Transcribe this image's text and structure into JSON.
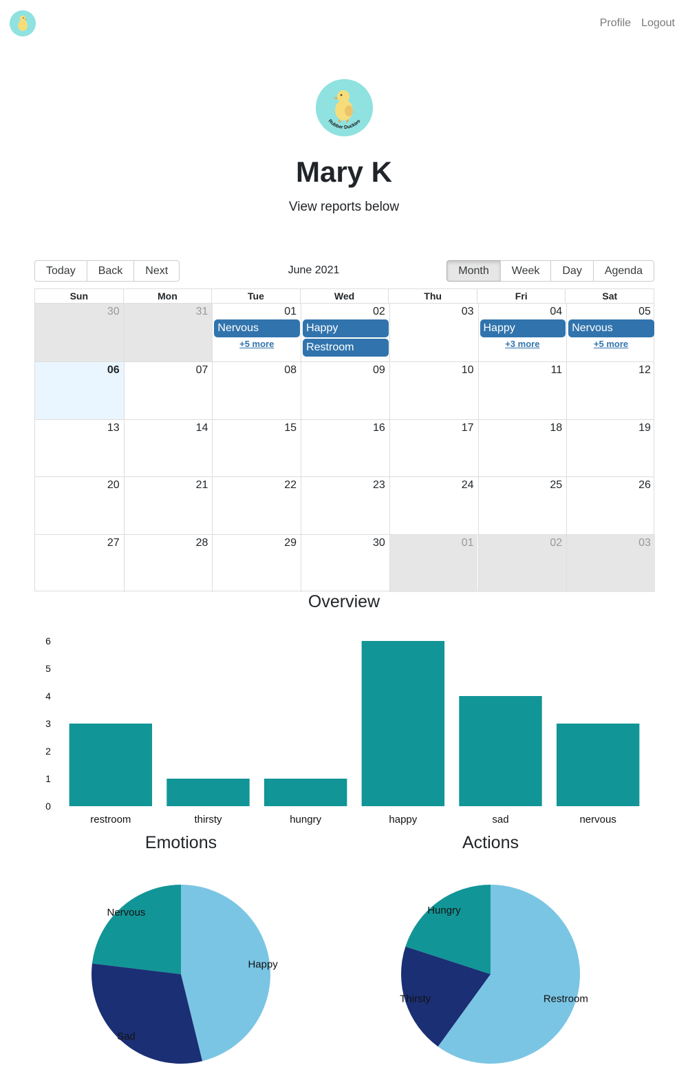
{
  "nav": {
    "links": [
      "Profile",
      "Logout"
    ]
  },
  "profile": {
    "logo_text": "Rubber Duckies",
    "name": "Mary K",
    "subtitle": "View reports below"
  },
  "calendar": {
    "nav_buttons": [
      "Today",
      "Back",
      "Next"
    ],
    "label": "June 2021",
    "views": [
      "Month",
      "Week",
      "Day",
      "Agenda"
    ],
    "active_view": "Month",
    "weekdays": [
      "Sun",
      "Mon",
      "Tue",
      "Wed",
      "Thu",
      "Fri",
      "Sat"
    ],
    "weeks": [
      [
        {
          "date": "30",
          "off": true
        },
        {
          "date": "31",
          "off": true
        },
        {
          "date": "01",
          "events": [
            "Nervous"
          ],
          "more": "+5 more"
        },
        {
          "date": "02",
          "events": [
            "Happy",
            "Restroom"
          ]
        },
        {
          "date": "03"
        },
        {
          "date": "04",
          "events": [
            "Happy"
          ],
          "more": "+3 more"
        },
        {
          "date": "05",
          "events": [
            "Nervous"
          ],
          "more": "+5 more"
        }
      ],
      [
        {
          "date": "06",
          "today": true
        },
        {
          "date": "07"
        },
        {
          "date": "08"
        },
        {
          "date": "09"
        },
        {
          "date": "10"
        },
        {
          "date": "11"
        },
        {
          "date": "12"
        }
      ],
      [
        {
          "date": "13"
        },
        {
          "date": "14"
        },
        {
          "date": "15"
        },
        {
          "date": "16"
        },
        {
          "date": "17"
        },
        {
          "date": "18"
        },
        {
          "date": "19"
        }
      ],
      [
        {
          "date": "20"
        },
        {
          "date": "21"
        },
        {
          "date": "22"
        },
        {
          "date": "23"
        },
        {
          "date": "24"
        },
        {
          "date": "25"
        },
        {
          "date": "26"
        }
      ],
      [
        {
          "date": "27"
        },
        {
          "date": "28"
        },
        {
          "date": "29"
        },
        {
          "date": "30"
        },
        {
          "date": "01",
          "off": true
        },
        {
          "date": "02",
          "off": true
        },
        {
          "date": "03",
          "off": true
        }
      ]
    ],
    "event_color": "#3174ad"
  },
  "chart_data": [
    {
      "type": "bar",
      "title": "Overview",
      "categories": [
        "restroom",
        "thirsty",
        "hungry",
        "happy",
        "sad",
        "nervous"
      ],
      "values": [
        3,
        1,
        1,
        6,
        4,
        3
      ],
      "yticks": [
        0,
        1,
        2,
        3,
        4,
        5,
        6
      ],
      "ylim": [
        0,
        6
      ],
      "grid": false,
      "color": "#129596"
    },
    {
      "type": "pie",
      "title": "Emotions",
      "labels": [
        "Happy",
        "Sad",
        "Nervous"
      ],
      "values": [
        6,
        4,
        3
      ],
      "colors": [
        "#7bc5e4",
        "#1b2f74",
        "#129596"
      ]
    },
    {
      "type": "pie",
      "title": "Actions",
      "labels": [
        "Restroom",
        "Thirsty",
        "Hungry"
      ],
      "values": [
        3,
        1,
        1
      ],
      "colors": [
        "#7bc5e4",
        "#1b2f74",
        "#129596"
      ]
    }
  ]
}
